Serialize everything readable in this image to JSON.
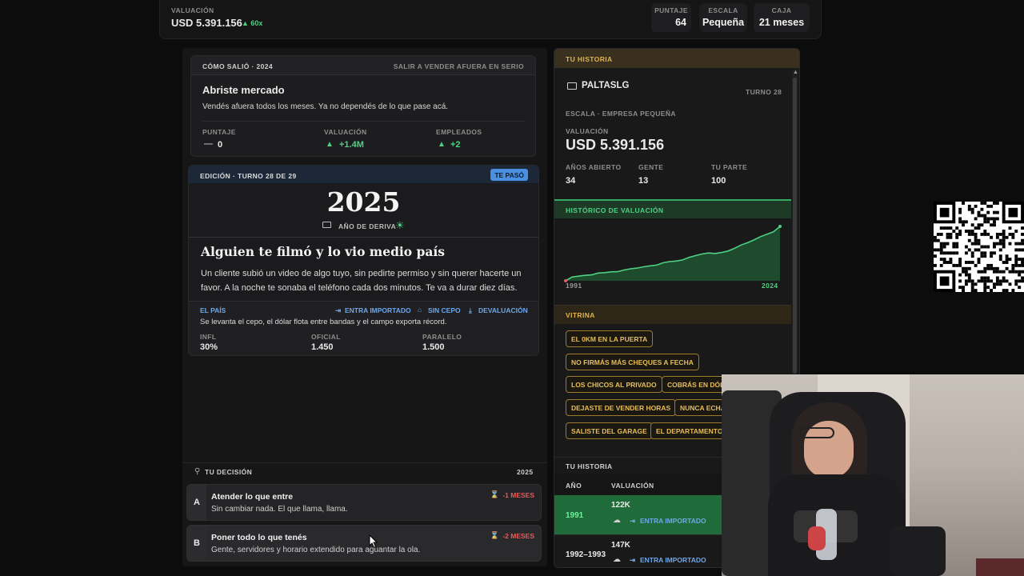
{
  "topbar": {
    "valuation_label": "VALUACIÓN",
    "valuation_value": "USD 5.391.156",
    "valuation_delta": "▲ 60x",
    "stats": [
      {
        "label": "PUNTAJE",
        "value": "64"
      },
      {
        "label": "ESCALA",
        "value": "Pequeña"
      },
      {
        "label": "CAJA",
        "value": "21 meses"
      }
    ]
  },
  "result_card": {
    "header_left": "CÓMO SALIÓ · 2024",
    "header_right": "SALIR A VENDER AFUERA EN SERIO",
    "title": "Abriste mercado",
    "body": "Vendés afuera todos los meses. Ya no dependés de lo que pase acá.",
    "metrics": [
      {
        "label": "PUNTAJE",
        "arrow": "—",
        "value": "0"
      },
      {
        "label": "VALUACIÓN",
        "arrow": "▲",
        "value": "+1.4M"
      },
      {
        "label": "EMPLEADOS",
        "arrow": "▲",
        "value": "+2"
      }
    ]
  },
  "edition": {
    "header": "EDICIÓN · TURNO 28 DE 29",
    "badge": "TE PASÓ",
    "year": "2025",
    "subtitle": "AÑO DE DERIVA",
    "headline": "Alguien te filmó y lo vio medio país",
    "body": "Un cliente subió un video de algo tuyo, sin pedirte permiso y sin querer hacerte un favor. A la noche te sonaba el teléfono cada dos minutos. Te va a durar diez días.",
    "section": "EL PAÍS",
    "tags": [
      "ENTRA IMPORTADO",
      "SIN CEPO",
      "DEVALUACIÓN"
    ],
    "country_text": "Se levanta el cepo, el dólar flota entre bandas y el campo exporta récord.",
    "indicators": [
      {
        "label": "INFL",
        "value": "30%"
      },
      {
        "label": "OFICIAL",
        "value": "1.450"
      },
      {
        "label": "PARALELO",
        "value": "1.500"
      }
    ]
  },
  "decision": {
    "label": "TU DECISIÓN",
    "year": "2025",
    "options": [
      {
        "letter": "A",
        "title": "Atender lo que entre",
        "desc": "Sin cambiar nada. El que llama, llama.",
        "cost": "-1 MESES"
      },
      {
        "letter": "B",
        "title": "Poner todo lo que tenés",
        "desc": "Gente, servidores y horario extendido para aguantar la ola.",
        "cost": "-2 MESES"
      }
    ]
  },
  "history": {
    "header": "TU HISTORIA",
    "company": "PALTASLG",
    "turn": "TURNO 28",
    "scale": "ESCALA · EMPRESA PEQUEÑA",
    "valuation_label": "VALUACIÓN",
    "valuation_value": "USD 5.391.156",
    "stats": [
      {
        "label": "AÑOS ABIERTO",
        "value": "34"
      },
      {
        "label": "GENTE",
        "value": "13"
      },
      {
        "label": "TU PARTE",
        "value": "100"
      }
    ],
    "chart_header": "HISTÓRICO DE VALUACIÓN",
    "vitrina_header": "VITRINA",
    "chips": [
      "EL 0KM EN LA PUERTA",
      "NO FIRMÁS MÁS CHEQUES A FECHA",
      "LOS CHICOS AL PRIVADO",
      "COBRÁS EN DÓL",
      "DEJASTE DE VENDER HORAS",
      "NUNCA ECHA",
      "SALISTE DEL GARAGE",
      "EL DEPARTAMENTO"
    ],
    "table_header": "TU HISTORIA",
    "table_cols": [
      "AÑO",
      "VALUACIÓN"
    ],
    "rows": [
      {
        "year": "1991",
        "value": "122K",
        "tag": "ENTRA IMPORTADO"
      },
      {
        "year": "1992–1993",
        "value": "147K",
        "tag": "ENTRA IMPORTADO"
      }
    ]
  },
  "chart_data": {
    "type": "area",
    "x_start_label": "1991",
    "x_end_label": "2024",
    "values": [
      122,
      147,
      160,
      175,
      185,
      230,
      240,
      265,
      270,
      330,
      380,
      410,
      470,
      520,
      560,
      700,
      780,
      820,
      900,
      1100,
      1250,
      1400,
      1500,
      1450,
      1550,
      1700,
      2000,
      2400,
      2700,
      3100,
      3600,
      4000,
      4400,
      5391
    ]
  },
  "colors": {
    "accent_green": "#4ed183",
    "accent_gold": "#e0b44a",
    "accent_blue": "#6fa7e8",
    "accent_red": "#e55b5b"
  }
}
